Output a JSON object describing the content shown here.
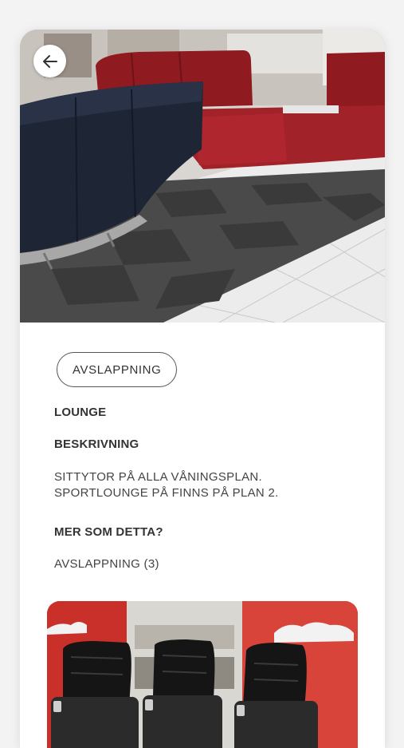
{
  "header": {
    "back_icon": "arrow-left-icon",
    "hero_image": "lounge seating area with red and navy sofas on checkered carpet"
  },
  "detail": {
    "category_chip": "AVSLAPPNING",
    "title": "LOUNGE",
    "description_label": "BESKRIVNING",
    "description_lines": [
      "SITTYTOR PÅ ALLA VÅNINGSPLAN.",
      "SPORTLOUNGE PÅ FINNS PÅ PLAN 2."
    ],
    "more_label": "MER SOM DETTA?",
    "more_link": "AVSLAPPNING (3)"
  },
  "related": {
    "image": "massage chairs in front of red wall"
  },
  "colors": {
    "background": "#f3f3f4",
    "card": "#ffffff",
    "text": "#333333",
    "sofa_red": "#9e1f24",
    "sofa_navy": "#1e2535"
  }
}
